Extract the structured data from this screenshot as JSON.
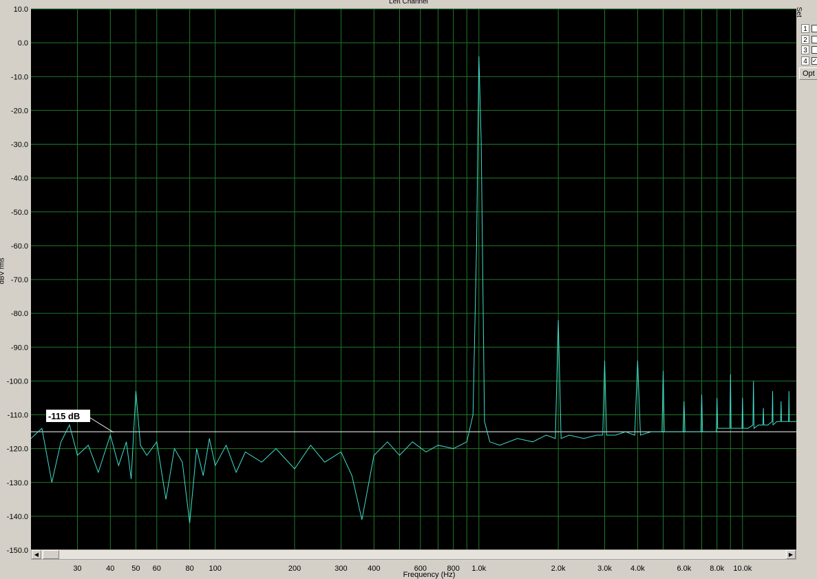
{
  "window": {
    "set_label": "Set",
    "traces": [
      {
        "label": "1",
        "checked": false
      },
      {
        "label": "2",
        "checked": false
      },
      {
        "label": "3",
        "checked": false
      },
      {
        "label": "4",
        "checked": true
      }
    ],
    "options_label": "Opt"
  },
  "chart_data": {
    "type": "line",
    "title": "Left Channel",
    "xlabel": "Frequency (Hz)",
    "ylabel": "dBV rms",
    "x_scale": "log",
    "xlim": [
      20,
      16000
    ],
    "ylim": [
      -150,
      10
    ],
    "grid": true,
    "background": "#000000",
    "grid_color": "#1f7a2a",
    "trace_color": "#40e0d0",
    "y_ticks": [
      "10.0",
      "0.0",
      "-10.0",
      "-20.0",
      "-30.0",
      "-40.0",
      "-50.0",
      "-60.0",
      "-70.0",
      "-80.0",
      "-90.0",
      "-100.0",
      "-110.0",
      "-120.0",
      "-130.0",
      "-140.0",
      "-150.0"
    ],
    "y_tick_values": [
      10,
      0,
      -10,
      -20,
      -30,
      -40,
      -50,
      -60,
      -70,
      -80,
      -90,
      -100,
      -110,
      -120,
      -130,
      -140,
      -150
    ],
    "x_ticks": [
      {
        "value": 30,
        "label": "30"
      },
      {
        "value": 40,
        "label": "40"
      },
      {
        "value": 50,
        "label": "50"
      },
      {
        "value": 60,
        "label": "60"
      },
      {
        "value": 80,
        "label": "80"
      },
      {
        "value": 100,
        "label": "100"
      },
      {
        "value": 200,
        "label": "200"
      },
      {
        "value": 300,
        "label": "300"
      },
      {
        "value": 400,
        "label": "400"
      },
      {
        "value": 600,
        "label": "600"
      },
      {
        "value": 800,
        "label": "800"
      },
      {
        "value": 1000,
        "label": "1.0k"
      },
      {
        "value": 2000,
        "label": "2.0k"
      },
      {
        "value": 3000,
        "label": "3.0k"
      },
      {
        "value": 4000,
        "label": "4.0k"
      },
      {
        "value": 6000,
        "label": "6.0k"
      },
      {
        "value": 8000,
        "label": "8.0k"
      },
      {
        "value": 10000,
        "label": "10.0k"
      }
    ],
    "minor_grid_x": [
      500,
      700,
      900,
      5000,
      7000,
      9000
    ],
    "reference_line": {
      "value": -115,
      "label": "-115 dB"
    },
    "series": [
      {
        "x": [
          20,
          22,
          24,
          26,
          28,
          30,
          33,
          36,
          40,
          43,
          46,
          48,
          50,
          52,
          55,
          60,
          65,
          70,
          75,
          80,
          85,
          90,
          95,
          100,
          110,
          120,
          130,
          150,
          170,
          200,
          230,
          260,
          300,
          330,
          360,
          400,
          450,
          500,
          560,
          630,
          700,
          800,
          900,
          950,
          980,
          1000,
          1020,
          1050,
          1100,
          1200,
          1400,
          1600,
          1800,
          1950,
          2000,
          2050,
          2200,
          2500,
          2800,
          2950,
          3000,
          3050,
          3300,
          3600,
          3900,
          4000,
          4100,
          4500,
          4950,
          5000,
          5050,
          5500,
          5950,
          6000,
          6050,
          6500,
          6950,
          7000,
          7050,
          7500,
          7950,
          8000,
          8050,
          8500,
          8950,
          9000,
          9050,
          9500,
          9950,
          10000,
          10050,
          10500,
          10950,
          11000,
          11050,
          11500,
          11950,
          12000,
          12050,
          12500,
          12950,
          13000,
          13050,
          13500,
          13950,
          14000,
          14050,
          14500,
          14950,
          15000,
          15050,
          15500,
          16000
        ],
        "y": [
          -117,
          -114,
          -130,
          -118,
          -113,
          -122,
          -119,
          -127,
          -116,
          -125,
          -118,
          -129,
          -103,
          -119,
          -122,
          -118,
          -135,
          -120,
          -124,
          -142,
          -120,
          -128,
          -117,
          -125,
          -119,
          -127,
          -121,
          -124,
          -120,
          -126,
          -119,
          -124,
          -121,
          -128,
          -141,
          -122,
          -118,
          -122,
          -118,
          -121,
          -119,
          -120,
          -118,
          -110,
          -60,
          -4,
          -29,
          -112,
          -118,
          -119,
          -117,
          -118,
          -116,
          -117,
          -82,
          -117,
          -116,
          -117,
          -116,
          -116,
          -94,
          -116,
          -116,
          -115,
          -116,
          -94,
          -116,
          -115,
          -115,
          -97,
          -115,
          -115,
          -115,
          -106,
          -115,
          -115,
          -115,
          -104,
          -115,
          -115,
          -115,
          -105,
          -114,
          -114,
          -114,
          -98,
          -114,
          -114,
          -114,
          -105,
          -114,
          -114,
          -113,
          -100,
          -114,
          -113,
          -113,
          -108,
          -113,
          -113,
          -112,
          -103,
          -113,
          -112,
          -112,
          -106,
          -112,
          -112,
          -112,
          -103,
          -112,
          -112,
          -112
        ]
      }
    ]
  }
}
